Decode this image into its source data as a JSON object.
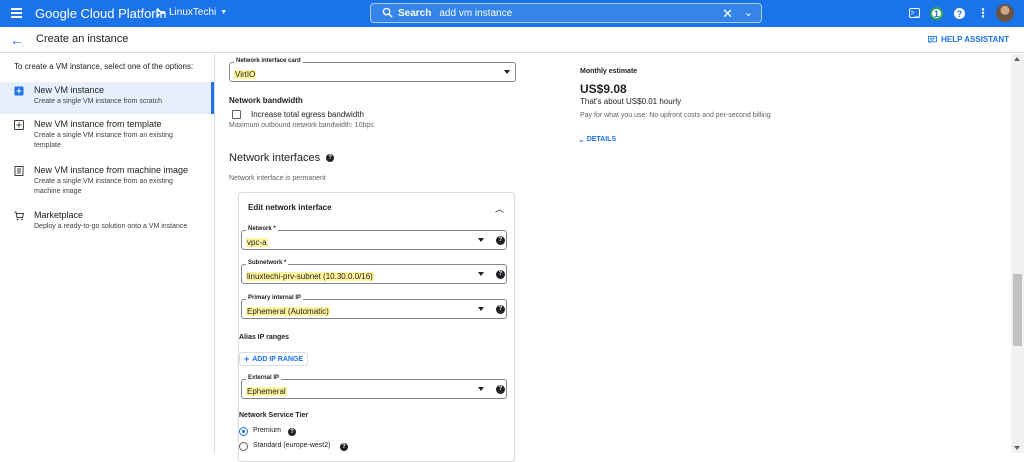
{
  "topbar": {
    "brand": "Google Cloud Platform",
    "project": "LinuxTechi",
    "search_label": "Search",
    "search_value": "add vm instance",
    "notification_count": "1",
    "help": "?",
    "more": "⋮",
    "brand_color": "#1a73e8"
  },
  "header": {
    "back_icon": "←",
    "title": "Create an instance",
    "assistant": "HELP ASSISTANT"
  },
  "sidebar": {
    "intro": "To create a VM instance, select one of the options:",
    "options": [
      {
        "title": "New VM instance",
        "desc": "Create a single VM instance from scratch",
        "active": true
      },
      {
        "title": "New VM instance from template",
        "desc": "Create a single VM instance from an existing template"
      },
      {
        "title": "New VM instance from machine image",
        "desc": "Create a single VM instance from an existing machine image"
      },
      {
        "title": "Marketplace",
        "desc": "Deploy a ready-to-go solution onto a VM instance"
      }
    ]
  },
  "form": {
    "nic_label": "Network interface card",
    "nic_value": "VirtIO",
    "bandwidth_title": "Network bandwidth",
    "bandwidth_checkbox": "Increase total egress bandwidth",
    "bandwidth_max": "Maximum outbound network bandwidth: 10bps",
    "ni_title": "Network interfaces",
    "ni_note": "Network interface is permanent",
    "edit_title": "Edit network interface",
    "network_label": "Network *",
    "network_value": "vpc-a",
    "subnet_label": "Subnetwork *",
    "subnet_value": "linuxtechi-prv-subnet (10.30.0.0/16)",
    "primary_ip_label": "Primary internal IP",
    "primary_ip_value": "Ephemeral (Automatic)",
    "alias_title": "Alias IP ranges",
    "add_ip_range": "ADD IP RANGE",
    "external_ip_label": "External IP",
    "external_ip_value": "Ephemeral",
    "tier_title": "Network Service Tier",
    "tier_premium": "Premium",
    "tier_standard": "Standard (europe-west2)"
  },
  "estimate": {
    "title": "Monthly estimate",
    "price": "US$9.08",
    "hourly": "That's about US$0.01 hourly",
    "note": "Pay for what you use: No upfront costs and per-second billing",
    "details": "DETAILS"
  }
}
